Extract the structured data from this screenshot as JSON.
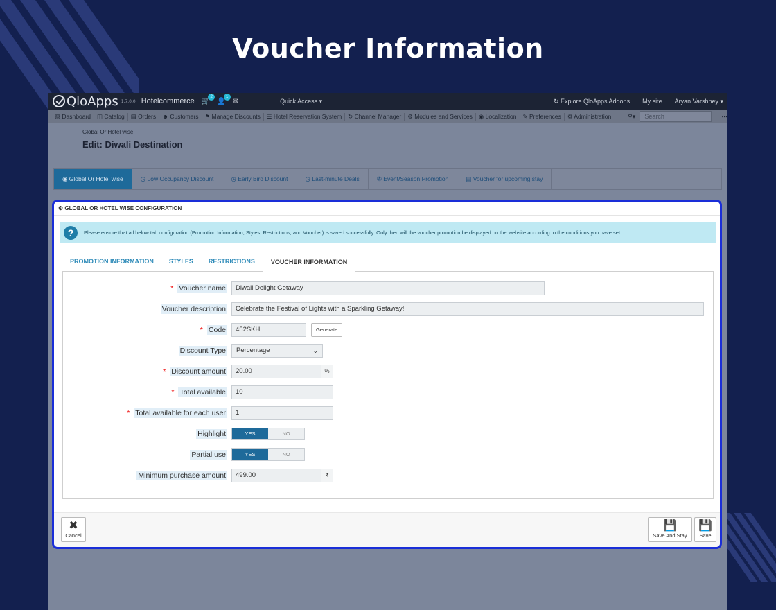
{
  "page": {
    "title": "Voucher Information"
  },
  "topbar": {
    "logo": "QloApps",
    "version": "1.7.0.0",
    "shop_name": "Hotelcommerce",
    "cart_count": "2",
    "customer_count": "1",
    "quick_access": "Quick Access",
    "explore_addons": "Explore QloApps Addons",
    "my_site": "My site",
    "user": "Aryan Varshney"
  },
  "nav": {
    "items": [
      "Dashboard",
      "Catalog",
      "Orders",
      "Customers",
      "Manage Discounts",
      "Hotel Reservation System",
      "Channel Manager",
      "Modules and Services",
      "Localization",
      "Preferences",
      "Administration"
    ],
    "search_placeholder": "Search"
  },
  "header": {
    "breadcrumb": "Global Or Hotel wise",
    "title": "Edit: Diwali Destination"
  },
  "promo_tabs": [
    "Global Or Hotel wise",
    "Low Occupancy Discount",
    "Early Bird Discount",
    "Last-minute Deals",
    "Event/Season Promotion",
    "Voucher for upcoming stay"
  ],
  "panel": {
    "heading": "GLOBAL OR HOTEL WISE CONFIGURATION",
    "alert": "Please ensure that all below tab configuration (Promotion Information, Styles, Restrictions, and Voucher) is saved successfully. Only then will the voucher promotion be displayed on the website according to the conditions you have set."
  },
  "subtabs": [
    "PROMOTION INFORMATION",
    "STYLES",
    "RESTRICTIONS",
    "VOUCHER INFORMATION"
  ],
  "form": {
    "voucher_name": {
      "label": "Voucher name",
      "value": "Diwali Delight Getaway"
    },
    "voucher_description": {
      "label": "Voucher description",
      "value": "Celebrate the Festival of Lights with a Sparkling Getaway!"
    },
    "code": {
      "label": "Code",
      "value": "452SKH",
      "generate": "Generate"
    },
    "discount_type": {
      "label": "Discount Type",
      "value": "Percentage"
    },
    "discount_amount": {
      "label": "Discount amount",
      "value": "20.00",
      "unit": "%"
    },
    "total_available": {
      "label": "Total available",
      "value": "10"
    },
    "total_per_user": {
      "label": "Total available for each user",
      "value": "1"
    },
    "highlight": {
      "label": "Highlight",
      "yes": "YES",
      "no": "NO"
    },
    "partial_use": {
      "label": "Partial use",
      "yes": "YES",
      "no": "NO"
    },
    "min_purchase": {
      "label": "Minimum purchase amount",
      "value": "499.00",
      "unit": "₹"
    }
  },
  "footer": {
    "cancel": "Cancel",
    "save_and_stay": "Save And Stay",
    "save": "Save"
  },
  "colors": {
    "background": "#13204f",
    "accent": "#1e6a9a",
    "highlight_border": "#1a2ed8"
  }
}
